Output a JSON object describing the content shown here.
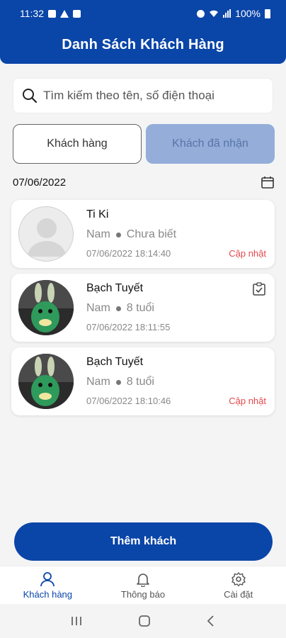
{
  "status_bar": {
    "time": "11:32",
    "battery": "100%"
  },
  "header": {
    "title": "Danh Sách Khách Hàng"
  },
  "search": {
    "placeholder": "Tìm kiếm theo tên, số điện thoại"
  },
  "tabs": [
    {
      "label": "Khách hàng",
      "active": true
    },
    {
      "label": "Khách đã nhận",
      "active": false
    }
  ],
  "date_filter": {
    "date": "07/06/2022",
    "icon": "calendar-icon"
  },
  "customers": [
    {
      "name": "Ti Ki",
      "gender": "Nam",
      "age": "Chưa biết",
      "timestamp": "07/06/2022 18:14:40",
      "action": "Cập nhật",
      "avatar": "default-avatar",
      "checked_icon": ""
    },
    {
      "name": "Bạch Tuyết",
      "gender": "Nam",
      "age": "8 tuổi",
      "timestamp": "07/06/2022 18:11:55",
      "action": "",
      "avatar": "photo-avatar",
      "checked_icon": "clipboard-check-icon"
    },
    {
      "name": "Bạch Tuyết",
      "gender": "Nam",
      "age": "8 tuổi",
      "timestamp": "07/06/2022 18:10:46",
      "action": "Cập nhật",
      "avatar": "photo-avatar",
      "checked_icon": ""
    }
  ],
  "add_button": {
    "label": "Thêm khách"
  },
  "bottom_nav": [
    {
      "label": "Khách hàng",
      "icon": "user-icon",
      "active": true
    },
    {
      "label": "Thông báo",
      "icon": "bell-icon",
      "active": false
    },
    {
      "label": "Cài đặt",
      "icon": "gear-icon",
      "active": false
    }
  ],
  "colors": {
    "primary": "#0a45a8",
    "tab_inactive_bg": "#94aed9",
    "update_red": "#e5484d",
    "background": "#f4f4f5"
  }
}
